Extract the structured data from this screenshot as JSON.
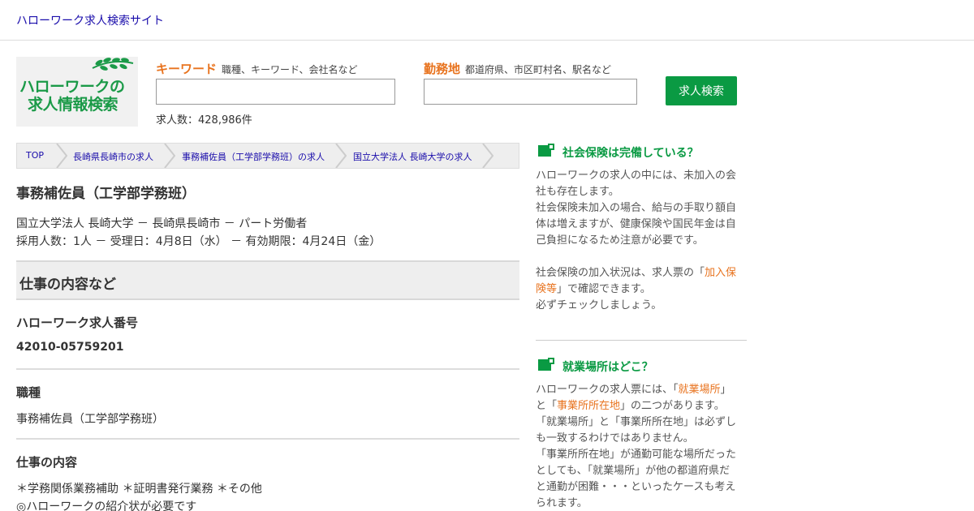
{
  "header": {
    "site_title": "ハローワーク求人検索サイト"
  },
  "logo": {
    "line1": "ハローワークの",
    "line2": "求人情報検索"
  },
  "search": {
    "keyword_label": "キーワード",
    "keyword_hint": "職種、キーワード、会社名など",
    "keyword_value": "",
    "location_label": "勤務地",
    "location_hint": "都道府県、市区町村名、駅名など",
    "location_value": "",
    "button_label": "求人検索",
    "count_text": "求人数：428,986件"
  },
  "breadcrumb": [
    {
      "label": "TOP"
    },
    {
      "label": "長崎県長崎市の求人"
    },
    {
      "label": "事務補佐員（工学部学務班）の求人"
    },
    {
      "label": "国立大学法人 長崎大学の求人"
    }
  ],
  "job": {
    "title": "事務補佐員（工学部学務班）",
    "meta_line1": "国立大学法人 長崎大学 － 長崎県長崎市 － パート労働者",
    "meta_line2": "採用人数：1人 － 受理日：4月8日（水） － 有効期限：4月24日（金）"
  },
  "section": {
    "heading": "仕事の内容など",
    "items": [
      {
        "label": "ハローワーク求人番号",
        "value": "42010-05759201"
      },
      {
        "label": "職種",
        "value": "事務補佐員（工学部学務班）"
      },
      {
        "label": "仕事の内容",
        "value_line1": "＊学務関係業務補助 ＊証明書発行業務 ＊その他",
        "value_line2": "◎ハローワークの紹介状が必要です"
      }
    ]
  },
  "sidebar": {
    "box1": {
      "title": "社会保険は完備している？",
      "icon": "cup-icon",
      "l1": "ハローワークの求人の中には、未加入の会",
      "l2": "社も存在します。",
      "l3": "社会保険未加入の場合、給与の手取り額自",
      "l4": "体は増えますが、健康保険や国民年金は自",
      "l5": "己負担になるため注意が必要です。",
      "l6a": "社会保険の加入状況は、求人票の「",
      "l6b": "加入保",
      "l7a": "険等",
      "l7b": "」で確認できます。",
      "l8": "必ずチェックしましょう。"
    },
    "box2": {
      "title": "就業場所はどこ？",
      "icon": "cup-icon",
      "l1a": "ハローワークの求人票には、「",
      "l1b": "就業場所",
      "l1c": "」",
      "l2a": "と「",
      "l2b": "事業所所在地",
      "l2c": "」の二つがあります。",
      "l3": "「就業場所」と「事業所所在地」は必ずし",
      "l4": "も一致するわけではありません。",
      "l5": "「事業所所在地」が通勤可能な場所だった",
      "l6": "としても、「就業場所」が他の都道府県だ",
      "l7": "と通勤が困難・・・といったケースも考え",
      "l8": "られます。"
    }
  },
  "colors": {
    "accent_green": "#0a9a43",
    "accent_orange": "#e8731e",
    "link_blue": "#1a0dab"
  }
}
